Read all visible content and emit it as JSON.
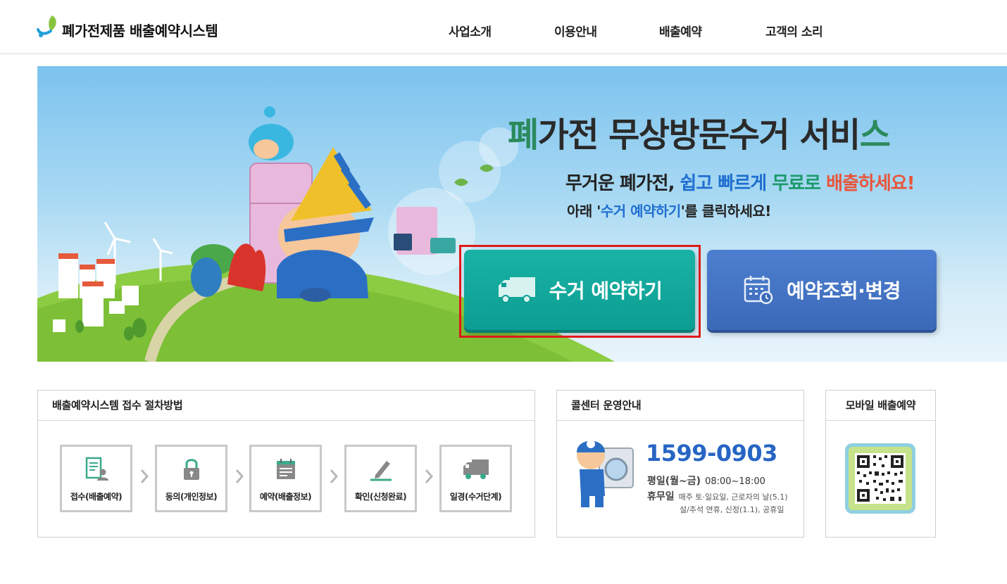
{
  "header": {
    "logo_text": "폐가전제품 배출예약시스템",
    "nav": [
      "사업소개",
      "이용안내",
      "배출예약",
      "고객의 소리"
    ]
  },
  "hero": {
    "title_accent_start": "폐",
    "title_middle": "가전 무상방문수거 서비",
    "title_accent_end": "스",
    "sub1_parts": [
      "무거운 ",
      "폐가전",
      ", ",
      "쉽고 빠르게",
      " ",
      "무료로",
      " ",
      "배출하세요!"
    ],
    "sub2_parts": [
      "아래 '",
      "수거 예약하기",
      "'를 클릭하세요!"
    ],
    "reserve_button": "수거 예약하기",
    "check_button": "예약조회·변경"
  },
  "procedure": {
    "title": "배출예약시스템 접수 절차방법",
    "steps": [
      {
        "label": "접수(배출예약)",
        "icon": "document-user-icon"
      },
      {
        "label": "동의(개인정보)",
        "icon": "lock-icon"
      },
      {
        "label": "예약(배출정보)",
        "icon": "calendar-note-icon"
      },
      {
        "label": "확인(신청완료)",
        "icon": "pen-icon"
      },
      {
        "label": "일경(수거단계)",
        "icon": "truck-icon"
      }
    ]
  },
  "callcenter": {
    "title": "콜센터 운영안내",
    "phone": "1599-0903",
    "weekday_label": "평일(월~금)",
    "weekday_hours": "08:00~18:00",
    "holiday_label": "휴무일",
    "holiday_text": "매주 토·일요일, 근로자의 날(5.1)",
    "holiday_text2": "설/추석 연휴, 신정(1.1), 공휴일"
  },
  "mobile": {
    "title": "모바일 배출예약"
  },
  "colors": {
    "accent_green": "#2b8a5c",
    "reserve_teal": "#0c9d92",
    "check_blue": "#3b69b8",
    "phone_blue": "#2765c4",
    "highlight_red": "#e01919"
  }
}
